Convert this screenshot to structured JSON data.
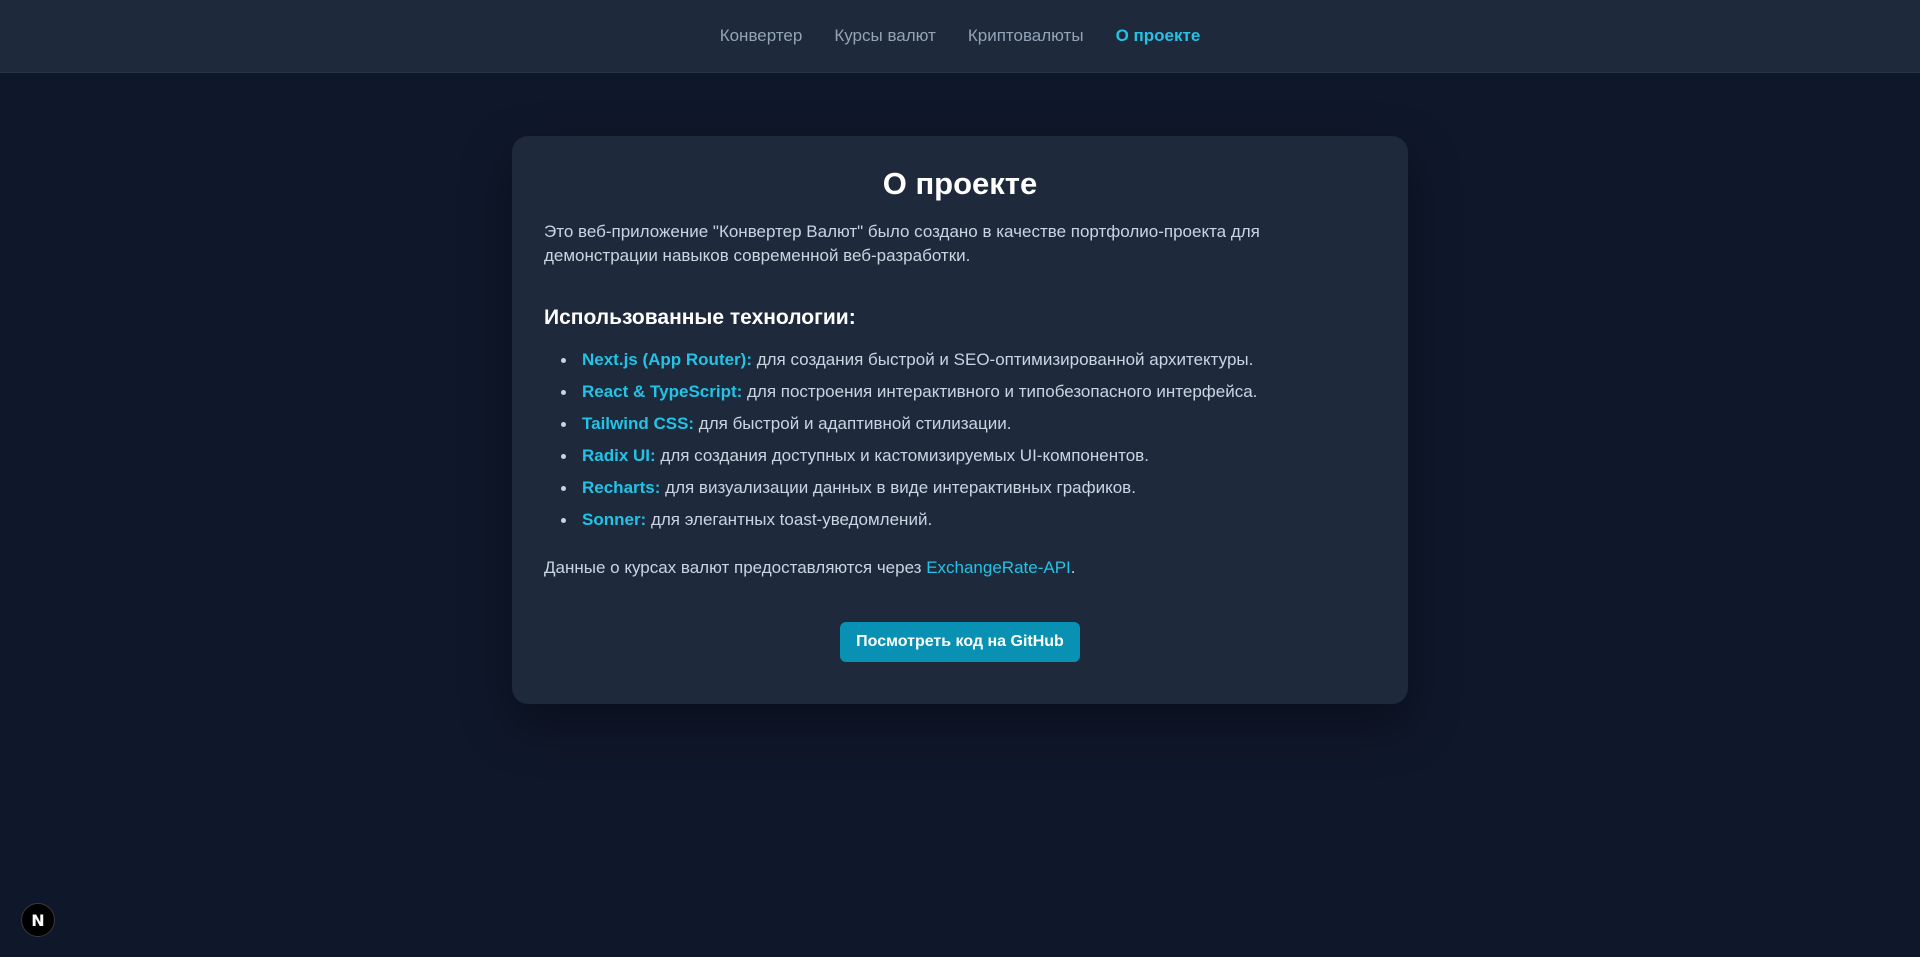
{
  "nav": {
    "items": [
      {
        "label": "Конвертер"
      },
      {
        "label": "Курсы валют"
      },
      {
        "label": "Криптовалюты"
      },
      {
        "label": "О проекте",
        "active": true
      }
    ]
  },
  "about": {
    "title": "О проекте",
    "intro": "Это веб-приложение \"Конвертер Валют\" было создано в качестве портфолио-проекта для демонстрации навыков современной веб-разработки.",
    "tech_heading": "Использованные технологии:",
    "technologies": [
      {
        "name": "Next.js (App Router):",
        "description": " для создания быстрой и SEO-оптимизированной архитектуры."
      },
      {
        "name": "React & TypeScript:",
        "description": " для построения интерактивного и типобезопасного интерфейса."
      },
      {
        "name": "Tailwind CSS:",
        "description": " для быстрой и адаптивной стилизации."
      },
      {
        "name": "Radix UI:",
        "description": " для создания доступных и кастомизируемых UI-компонентов."
      },
      {
        "name": "Recharts:",
        "description": " для визуализации данных в виде интерактивных графиков."
      },
      {
        "name": "Sonner:",
        "description": " для элегантных toast-уведомлений."
      }
    ],
    "source_prefix": "Данные о курсах валют предоставляются через ",
    "source_link": "ExchangeRate-API",
    "source_suffix": ".",
    "github_button": "Посмотреть код на GitHub"
  },
  "dev_badge": {
    "letter": "N",
    "icon": "nextjs-logo-icon"
  },
  "colors": {
    "page_bg": "#0f172a",
    "card_bg": "#1e293b",
    "accent": "#22c3e6",
    "button_bg": "#0891b2"
  }
}
